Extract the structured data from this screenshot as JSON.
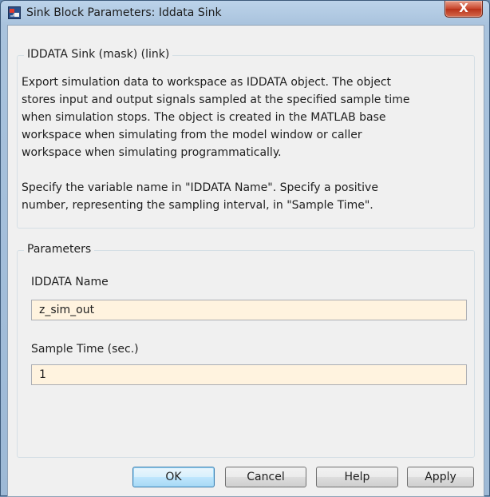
{
  "window": {
    "title": "Sink Block Parameters: Iddata Sink",
    "close_glyph": "X",
    "icon": "simulink-block-icon"
  },
  "mask": {
    "group_title": "IDDATA Sink (mask) (link)",
    "description": "Export simulation data to workspace as IDDATA object. The object\nstores input and output signals sampled at the specified sample time\nwhen simulation stops. The object is created in the MATLAB base\nworkspace when simulating from the model window or caller\nworkspace when simulating programmatically.\n\nSpecify the variable name in \"IDDATA Name\". Specify a positive\nnumber, representing the sampling interval, in \"Sample Time\"."
  },
  "parameters": {
    "group_title": "Parameters",
    "iddata_name": {
      "label": "IDDATA Name",
      "value": "z_sim_out"
    },
    "sample_time": {
      "label": "Sample Time (sec.)",
      "value": "1"
    }
  },
  "buttons": {
    "ok": "OK",
    "cancel": "Cancel",
    "help": "Help",
    "apply": "Apply"
  },
  "colors": {
    "input_background": "#fff3df",
    "default_button_border": "#3c7fb1",
    "close_button": "#c8452c"
  }
}
